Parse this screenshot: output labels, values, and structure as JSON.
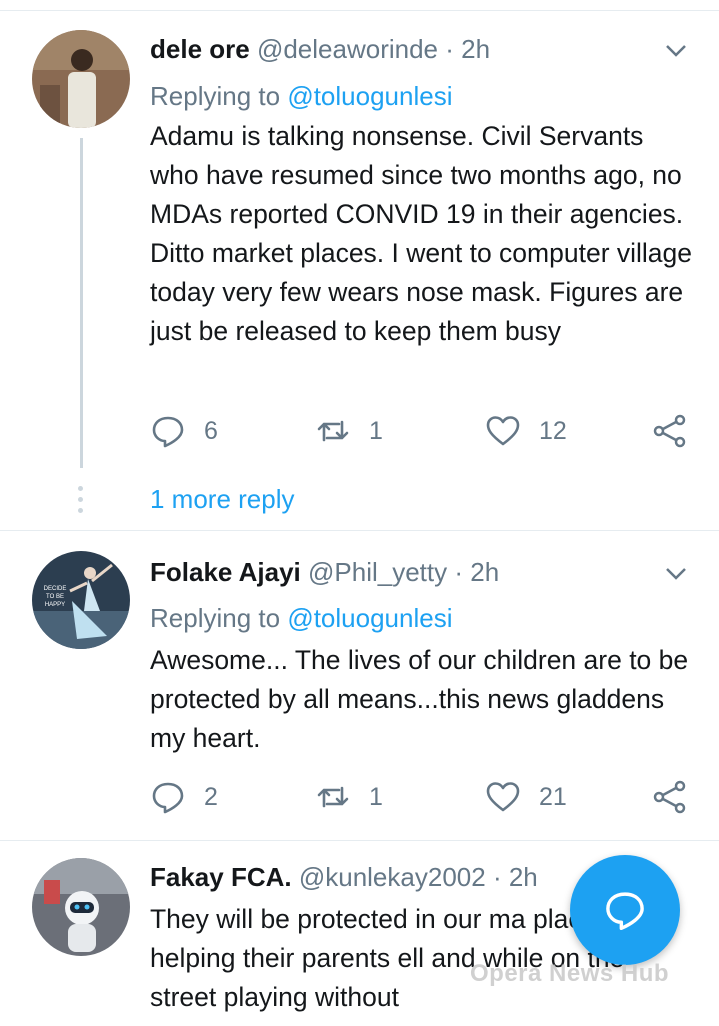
{
  "tweets": [
    {
      "name": "dele ore",
      "handle": "@deleaworinde",
      "time": "· 2h",
      "replying_prefix": "Replying to ",
      "replying_to": "@toluogunlesi",
      "text": "Adamu is talking nonsense. Civil Servants who have resumed since two months ago, no MDAs reported CONVID 19 in their agencies. Ditto market places. I went to computer village today very few wears nose mask. Figures are just be released to keep them busy",
      "replies": "6",
      "retweets": "1",
      "likes": "12"
    },
    {
      "name": "Folake Ajayi",
      "handle": "@Phil_yetty",
      "time": "· 2h",
      "replying_prefix": "Replying to ",
      "replying_to": "@toluogunlesi",
      "text": "Awesome... The lives of our children are to be protected by all means...this news gladdens my heart.",
      "replies": "2",
      "retweets": "1",
      "likes": "21",
      "avatar_caption": "DECIDE TO BE HAPPY"
    },
    {
      "name": "Fakay FCA.",
      "handle": "@kunlekay2002",
      "time": "· 2h",
      "text": "They will be protected in our ma places while helping their parents ell and while on the street playing without"
    }
  ],
  "more_reply": "1 more reply",
  "watermark": "Opera News Hub",
  "colors": {
    "accent": "#1da1f2",
    "muted": "#657786",
    "text": "#14171a"
  }
}
